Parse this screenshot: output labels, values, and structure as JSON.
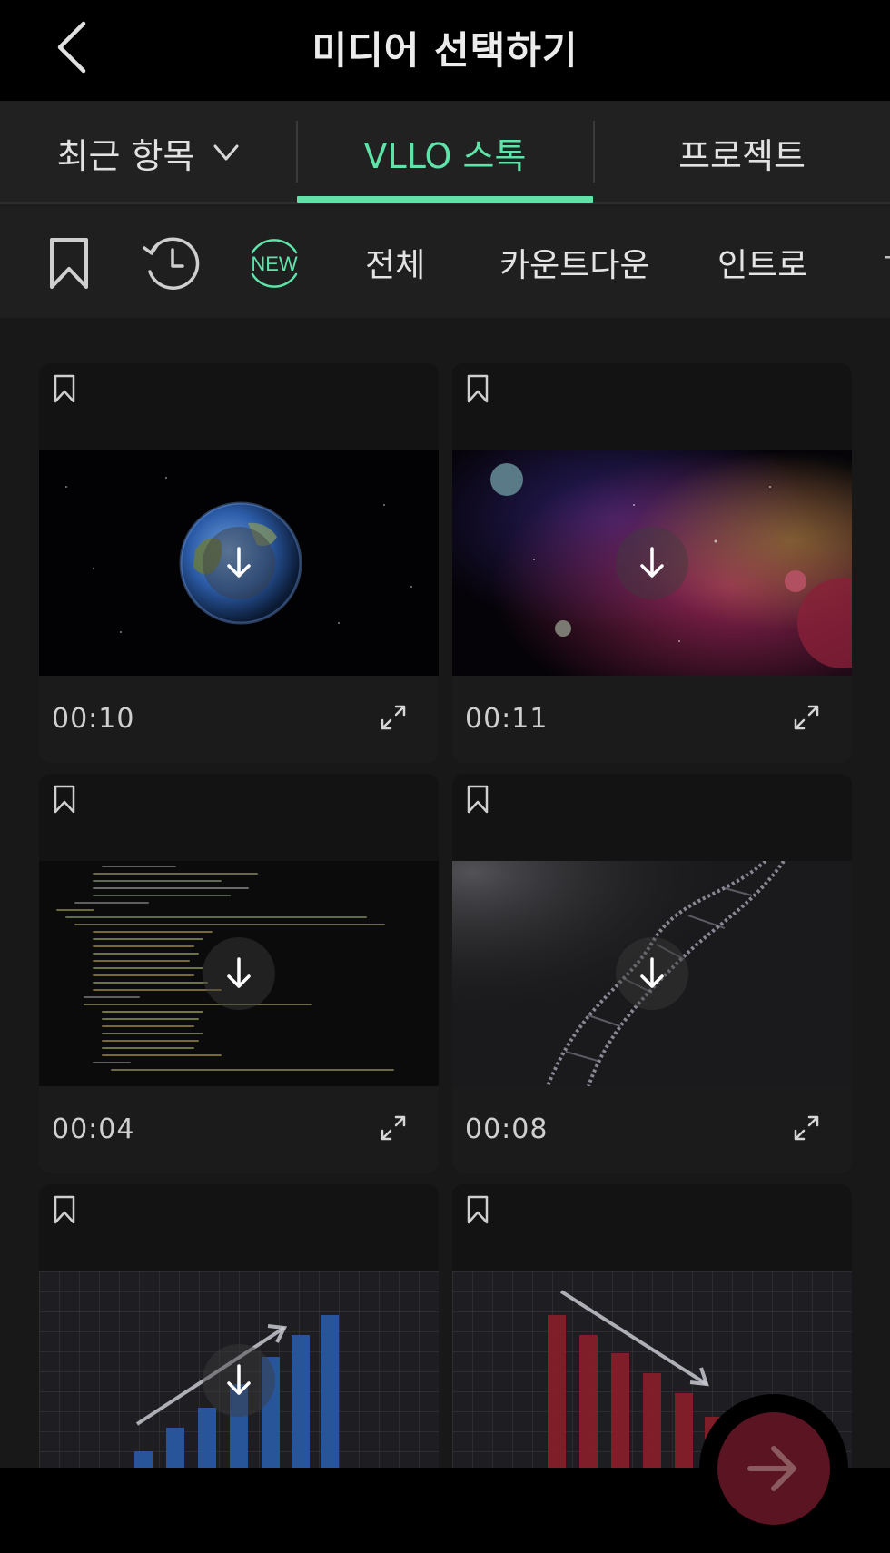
{
  "header": {
    "title": "미디어 선택하기",
    "back_icon": "chevron-left-icon"
  },
  "source_tabs": [
    {
      "label": "최근 항목",
      "has_dropdown": true,
      "active": false
    },
    {
      "label": "VLLO 스톡",
      "active": true
    },
    {
      "label": "프로젝트",
      "active": false
    }
  ],
  "categories": {
    "icons": [
      "bookmark-icon",
      "history-icon",
      "new-badge-icon"
    ],
    "new_badge": "NEW",
    "labels": [
      "전체",
      "카운트다운",
      "인트로"
    ]
  },
  "grid": {
    "items": [
      {
        "duration": "00:10",
        "scene": "earth"
      },
      {
        "duration": "00:11",
        "scene": "space-nebula"
      },
      {
        "duration": "00:04",
        "scene": "code"
      },
      {
        "duration": "00:08",
        "scene": "dna"
      },
      {
        "duration": "",
        "scene": "bar-chart-up"
      },
      {
        "duration": "",
        "scene": "bar-chart-down"
      }
    ]
  },
  "colors": {
    "accent": "#5fe3a8",
    "background": "#181818",
    "next_button": "#5a1422"
  },
  "next_button": {
    "icon": "arrow-right-icon"
  }
}
